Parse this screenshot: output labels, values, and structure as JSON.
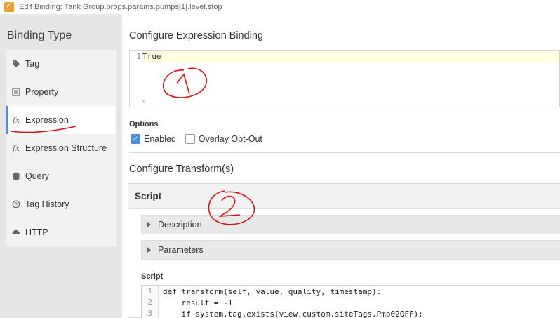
{
  "window": {
    "title": "Edit Binding: Tank Group.props.params.pumps[1].level.stop"
  },
  "sidebar": {
    "heading": "Binding Type",
    "items": [
      {
        "label": "Tag",
        "icon": "tag-icon"
      },
      {
        "label": "Property",
        "icon": "property-icon"
      },
      {
        "label": "Expression",
        "icon": "fx-icon"
      },
      {
        "label": "Expression Structure",
        "icon": "fx-icon"
      },
      {
        "label": "Query",
        "icon": "database-icon"
      },
      {
        "label": "Tag History",
        "icon": "clock-icon"
      },
      {
        "label": "HTTP",
        "icon": "cloud-icon"
      }
    ],
    "icon_glyphs": {
      "fx": "fx"
    }
  },
  "main": {
    "expression_title": "Configure Expression Binding",
    "expression_editor": {
      "line_number": "1",
      "code": "True"
    },
    "options": {
      "label": "Options",
      "enabled_label": "Enabled",
      "enabled_checked": true,
      "overlay_label": "Overlay Opt-Out",
      "overlay_checked": false
    },
    "transform_title": "Configure Transform(s)",
    "transform": {
      "header": "Script",
      "description_label": "Description",
      "parameters_label": "Parameters",
      "script_label": "Script",
      "code_lines": [
        {
          "n": "1",
          "text": "def transform(self, value, quality, timestamp):"
        },
        {
          "n": "2",
          "text": "    result = -1"
        },
        {
          "n": "3",
          "text": "    if system.tag.exists(view.custom.siteTags.Pmp02OFF):"
        }
      ]
    }
  },
  "colors": {
    "accent": "#4a90d9",
    "sidebar_bg": "#e6e6e6",
    "annotation": "#e01010",
    "line_highlight": "#ffffe0"
  }
}
